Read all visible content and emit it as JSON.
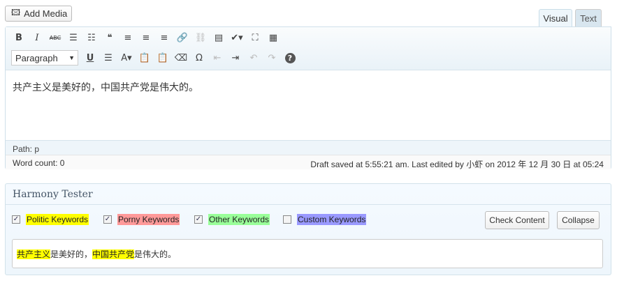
{
  "add_media": "Add Media",
  "tabs": [
    {
      "label": "Visual",
      "active": true
    },
    {
      "label": "Text",
      "active": false
    }
  ],
  "toolbar": {
    "row1": [
      {
        "icon": "bold-icon",
        "g": "B"
      },
      {
        "icon": "italic-icon",
        "g": "I"
      },
      {
        "icon": "strikethrough-icon",
        "g": "ABC"
      },
      {
        "icon": "bullet-list-icon",
        "g": "☰"
      },
      {
        "icon": "numbered-list-icon",
        "g": "☷"
      },
      {
        "icon": "blockquote-icon",
        "g": "❝"
      },
      {
        "icon": "align-left-icon",
        "g": "≡"
      },
      {
        "icon": "align-center-icon",
        "g": "≡"
      },
      {
        "icon": "align-right-icon",
        "g": "≡"
      },
      {
        "icon": "link-icon",
        "g": "🔗",
        "disabled": true
      },
      {
        "icon": "unlink-icon",
        "g": "⛓",
        "disabled": true
      },
      {
        "icon": "insert-more-icon",
        "g": "▤"
      },
      {
        "icon": "spellcheck-icon",
        "g": "✔▾"
      },
      {
        "icon": "fullscreen-icon",
        "g": "⛶"
      },
      {
        "icon": "kitchen-sink-icon",
        "g": "▦"
      }
    ],
    "format_select": "Paragraph",
    "row2": [
      {
        "icon": "underline-icon",
        "g": "U"
      },
      {
        "icon": "justify-icon",
        "g": "☰"
      },
      {
        "icon": "text-color-icon",
        "g": "A▾"
      },
      {
        "icon": "paste-text-icon",
        "g": "📋"
      },
      {
        "icon": "paste-word-icon",
        "g": "📋"
      },
      {
        "icon": "clear-formatting-icon",
        "g": "⌫"
      },
      {
        "icon": "special-character-icon",
        "g": "Ω"
      },
      {
        "icon": "outdent-icon",
        "g": "⇤",
        "disabled": true
      },
      {
        "icon": "indent-icon",
        "g": "⇥"
      },
      {
        "icon": "undo-icon",
        "g": "↶",
        "disabled": true
      },
      {
        "icon": "redo-icon",
        "g": "↷",
        "disabled": true
      },
      {
        "icon": "help-icon",
        "g": "?"
      }
    ]
  },
  "content": "共产主义是美好的，中国共产党是伟大的。",
  "path": "Path: p",
  "word_count": "Word count: 0",
  "draft_status": "Draft saved at 5:55:21 am. Last edited by 小虾 on 2012 年 12 月 30 日 at 05:24",
  "harmony": {
    "title": "Harmony Tester",
    "keywords": [
      {
        "label": "Politic Keywords",
        "checked": true,
        "color": "#ffff00"
      },
      {
        "label": "Porny Keywords",
        "checked": true,
        "color": "#ff9999"
      },
      {
        "label": "Other Keywords",
        "checked": true,
        "color": "#99ff99"
      },
      {
        "label": "Custom Keywords",
        "checked": false,
        "color": "#9999ff"
      }
    ],
    "check_button": "Check Content",
    "collapse_button": "Collapse",
    "result": [
      {
        "t": "共产主义",
        "hl": true
      },
      {
        "t": "是美好的，",
        "hl": false
      },
      {
        "t": "中国共产党",
        "hl": true
      },
      {
        "t": "是伟大的。",
        "hl": false
      }
    ]
  }
}
